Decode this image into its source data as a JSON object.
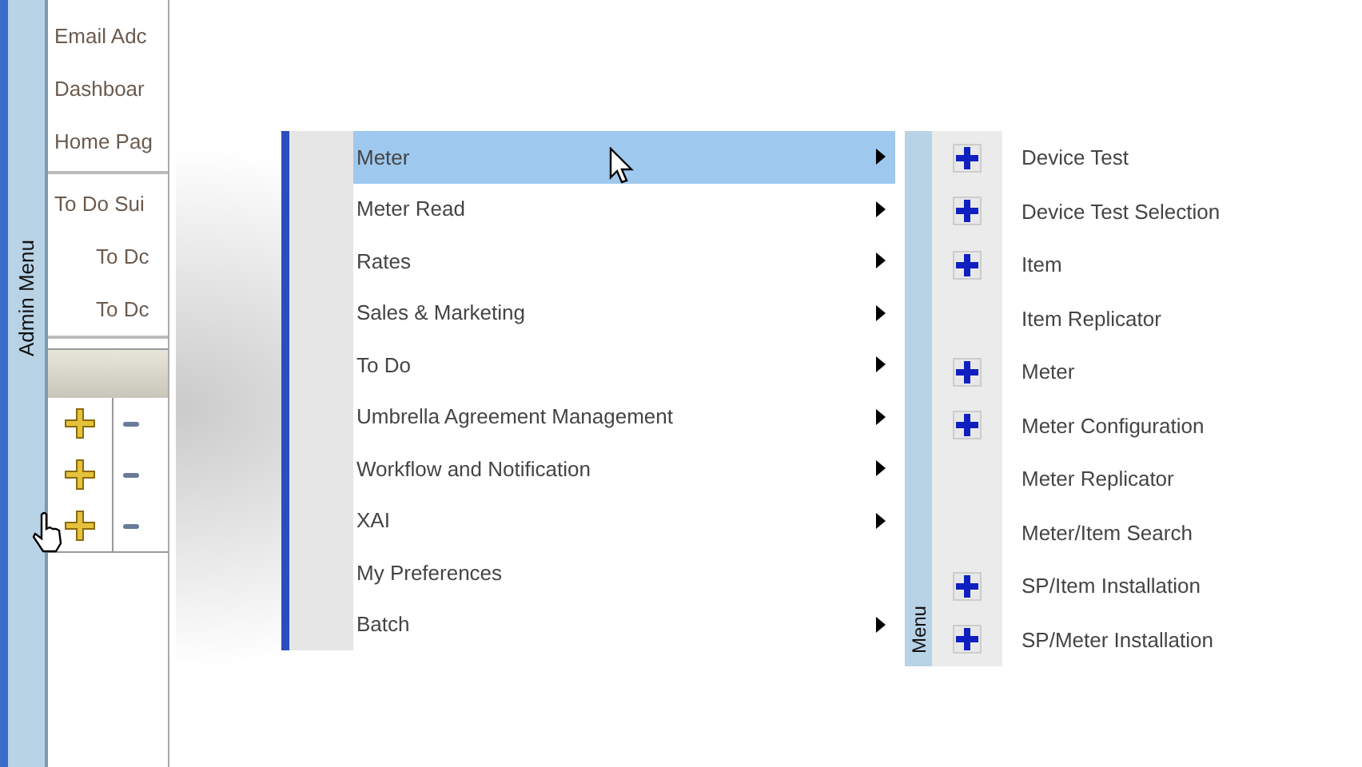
{
  "side_tab": {
    "label": "Admin Menu"
  },
  "left_panel": {
    "links": [
      "Email Adc",
      "Dashboar",
      "Home Pag"
    ],
    "todo": {
      "title": "To Do Sui",
      "items": [
        "To Dc",
        "To Dc"
      ]
    },
    "table": {
      "rows": [
        {
          "has_add_icon": true
        },
        {
          "has_add_icon": true
        },
        {
          "has_add_icon": true
        }
      ]
    }
  },
  "menu": {
    "items": [
      {
        "label": "Meter",
        "selected": true,
        "has_submenu": true
      },
      {
        "label": "Meter Read",
        "selected": false,
        "has_submenu": true
      },
      {
        "label": "Rates",
        "selected": false,
        "has_submenu": true
      },
      {
        "label": "Sales & Marketing",
        "selected": false,
        "has_submenu": true
      },
      {
        "label": "To Do",
        "selected": false,
        "has_submenu": true
      },
      {
        "label": "Umbrella Agreement Management",
        "selected": false,
        "has_submenu": true
      },
      {
        "label": "Workflow and Notification",
        "selected": false,
        "has_submenu": true
      },
      {
        "label": "XAI",
        "selected": false,
        "has_submenu": true
      },
      {
        "label": "My Preferences",
        "selected": false,
        "has_submenu": false
      },
      {
        "label": "Batch",
        "selected": false,
        "has_submenu": true
      }
    ]
  },
  "submenu": {
    "side_label": "Menu",
    "items": [
      {
        "label": "Device Test",
        "has_add_icon": true
      },
      {
        "label": "Device Test Selection",
        "has_add_icon": true
      },
      {
        "label": "Item",
        "has_add_icon": true
      },
      {
        "label": "Item Replicator",
        "has_add_icon": false
      },
      {
        "label": "Meter",
        "has_add_icon": true
      },
      {
        "label": "Meter Configuration",
        "has_add_icon": true
      },
      {
        "label": "Meter Replicator",
        "has_add_icon": false
      },
      {
        "label": "Meter/Item Search",
        "has_add_icon": false
      },
      {
        "label": "SP/Item Installation",
        "has_add_icon": true
      },
      {
        "label": "SP/Meter Installation",
        "has_add_icon": true
      }
    ]
  }
}
